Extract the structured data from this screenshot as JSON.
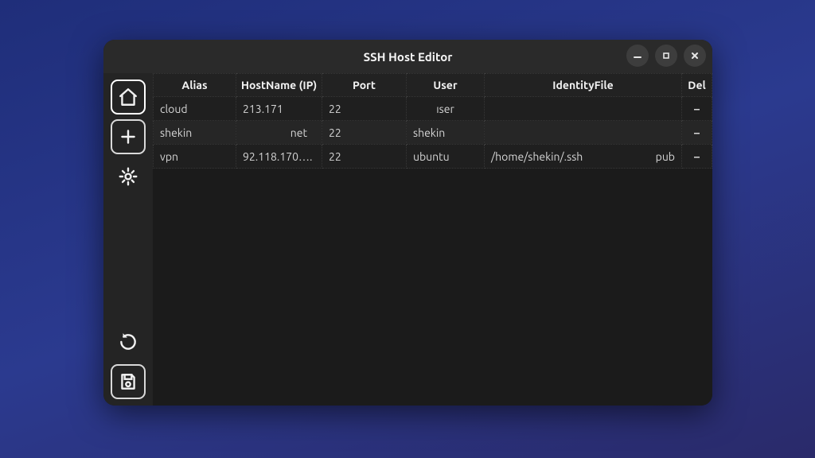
{
  "window": {
    "title": "SSH Host Editor"
  },
  "sidebar": {
    "home": {
      "name": "home-icon"
    },
    "add": {
      "name": "plus-icon"
    },
    "settings": {
      "name": "gear-icon"
    },
    "reload": {
      "name": "reload-icon"
    },
    "save": {
      "name": "save-icon"
    }
  },
  "table": {
    "headers": {
      "alias": "Alias",
      "hostname": "HostName (IP)",
      "port": "Port",
      "user": "User",
      "identityfile": "IdentityFile",
      "del": "Del"
    },
    "rows": [
      {
        "alias": "cloud",
        "hostname": "213.171",
        "port": "22",
        "user": "ıser",
        "identityfile": "",
        "identityfile_suffix": "",
        "del": "–"
      },
      {
        "alias": "shekin",
        "hostname": "net",
        "port": "22",
        "user": "shekin",
        "identityfile": "",
        "identityfile_suffix": "",
        "del": "–"
      },
      {
        "alias": "vpn",
        "hostname": "92.118.170….",
        "port": "22",
        "user": "ubuntu",
        "identityfile": "/home/shekin/.ssh",
        "identityfile_suffix": "pub",
        "del": "–"
      }
    ]
  }
}
